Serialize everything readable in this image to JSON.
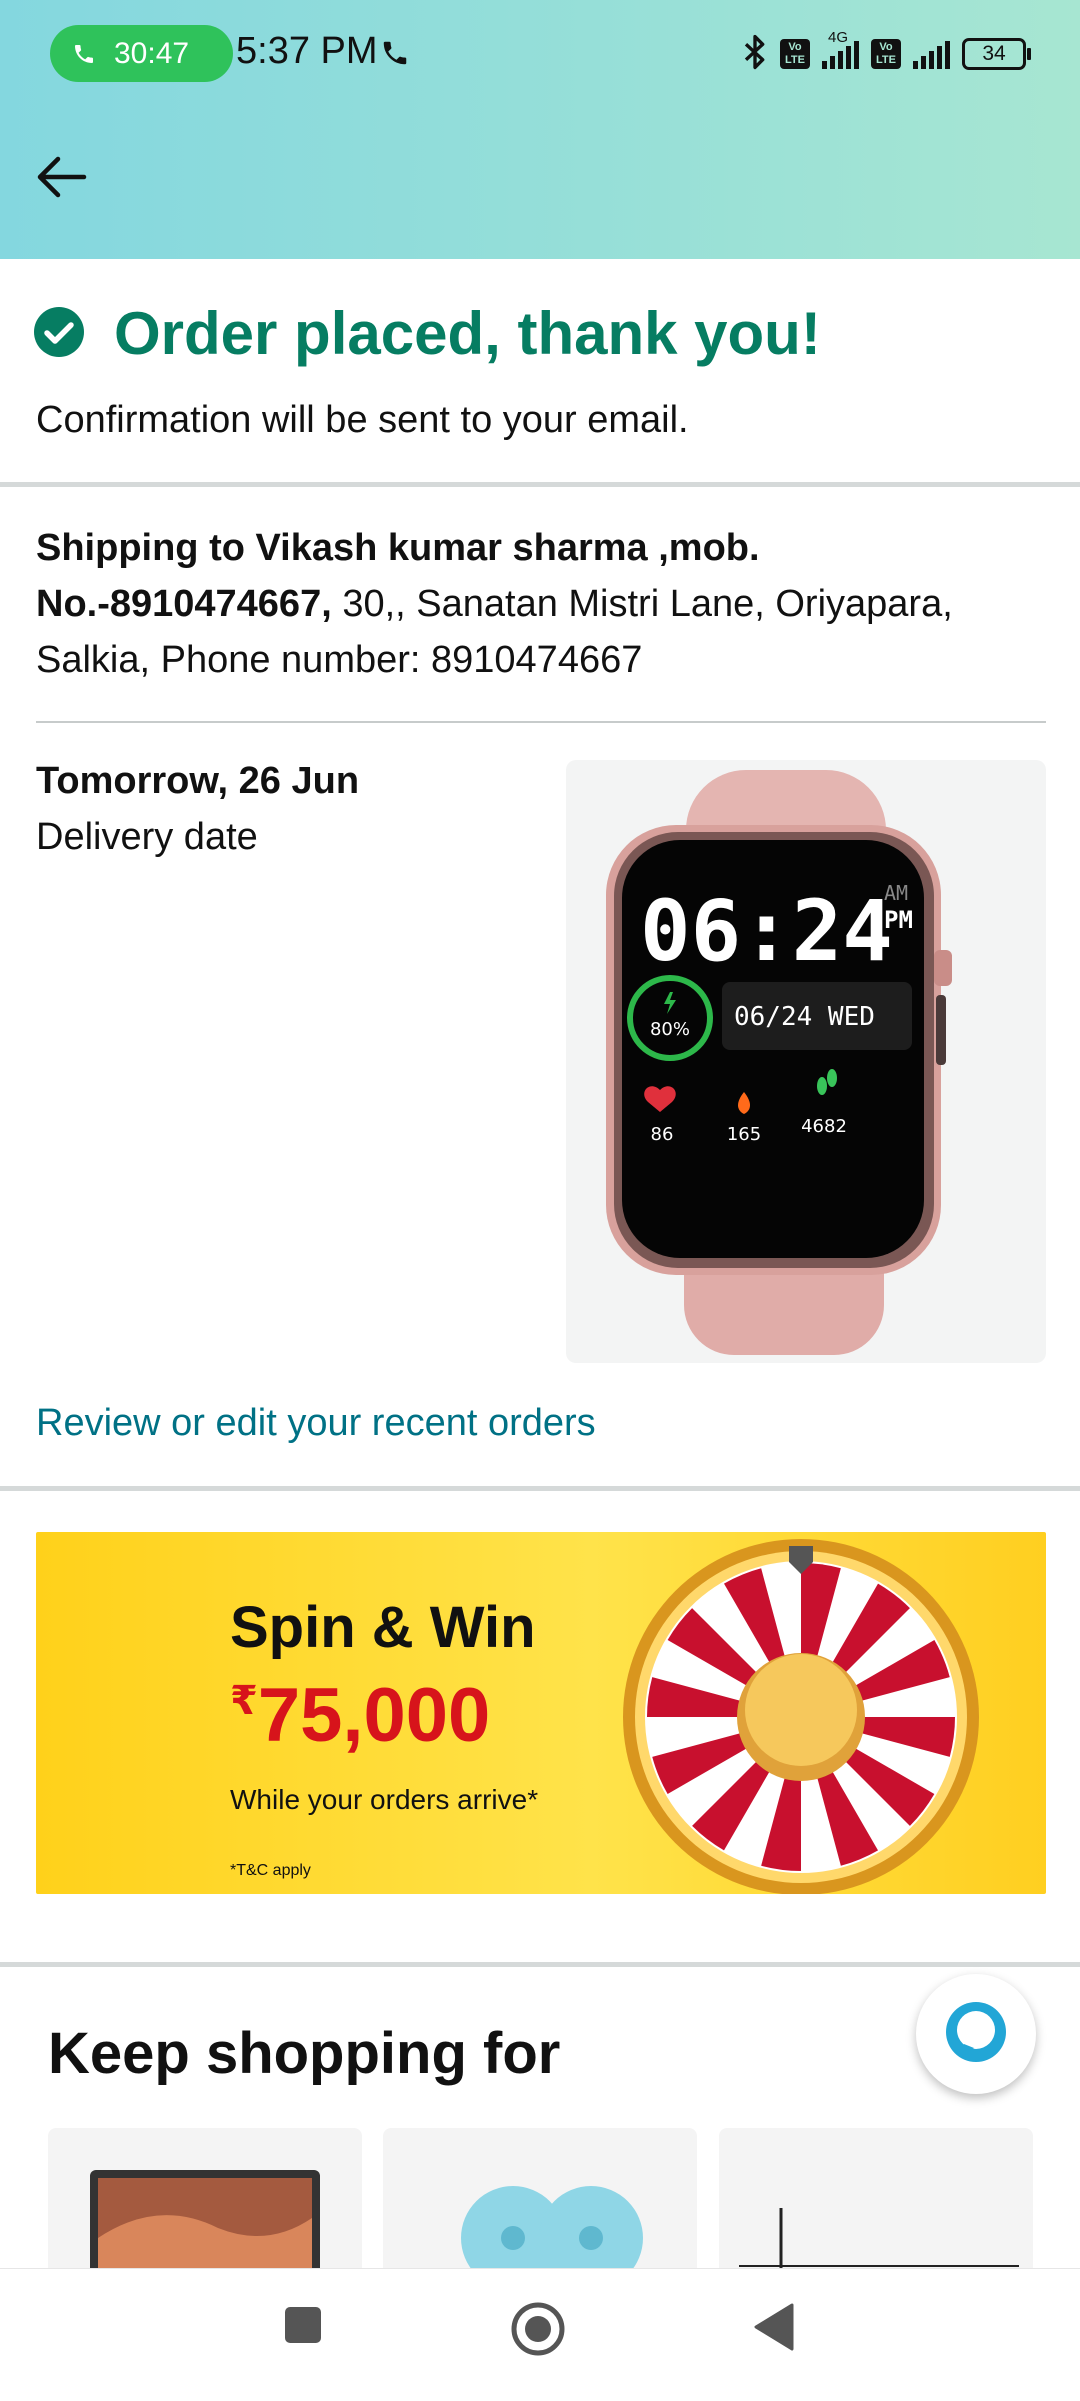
{
  "status_bar": {
    "call_timer": "30:47",
    "time": "5:37 PM",
    "network_label": "4G",
    "volte_label": "Vo LTE",
    "battery": "34"
  },
  "order": {
    "title": "Order placed, thank you!",
    "subtitle": "Confirmation will be sent to your email.",
    "shipping_bold": "Shipping to Vikash kumar sharma ,mob. No.-8910474667,",
    "shipping_address": " 30,, Sanatan Mistri Lane, Oriyapara, Salkia, Phone number: 8910474667",
    "delivery_date": "Tomorrow, 26 Jun",
    "delivery_label": "Delivery date",
    "review_link": "Review or edit your recent orders"
  },
  "product_image": {
    "time": "06:24",
    "ampm_top": "AM",
    "ampm_bottom": "PM",
    "battery": "80%",
    "date": "06/24 WED",
    "heart": "86",
    "calories": "165",
    "steps": "4682"
  },
  "banner": {
    "title": "Spin & Win",
    "currency": "₹",
    "amount": "75,000",
    "subtitle": "While your orders arrive*",
    "tc": "*T&C apply"
  },
  "keep_shopping": {
    "title": "Keep shopping for"
  },
  "colors": {
    "accent_green": "#067d62",
    "link": "#007185",
    "banner_red": "#d7141b"
  }
}
